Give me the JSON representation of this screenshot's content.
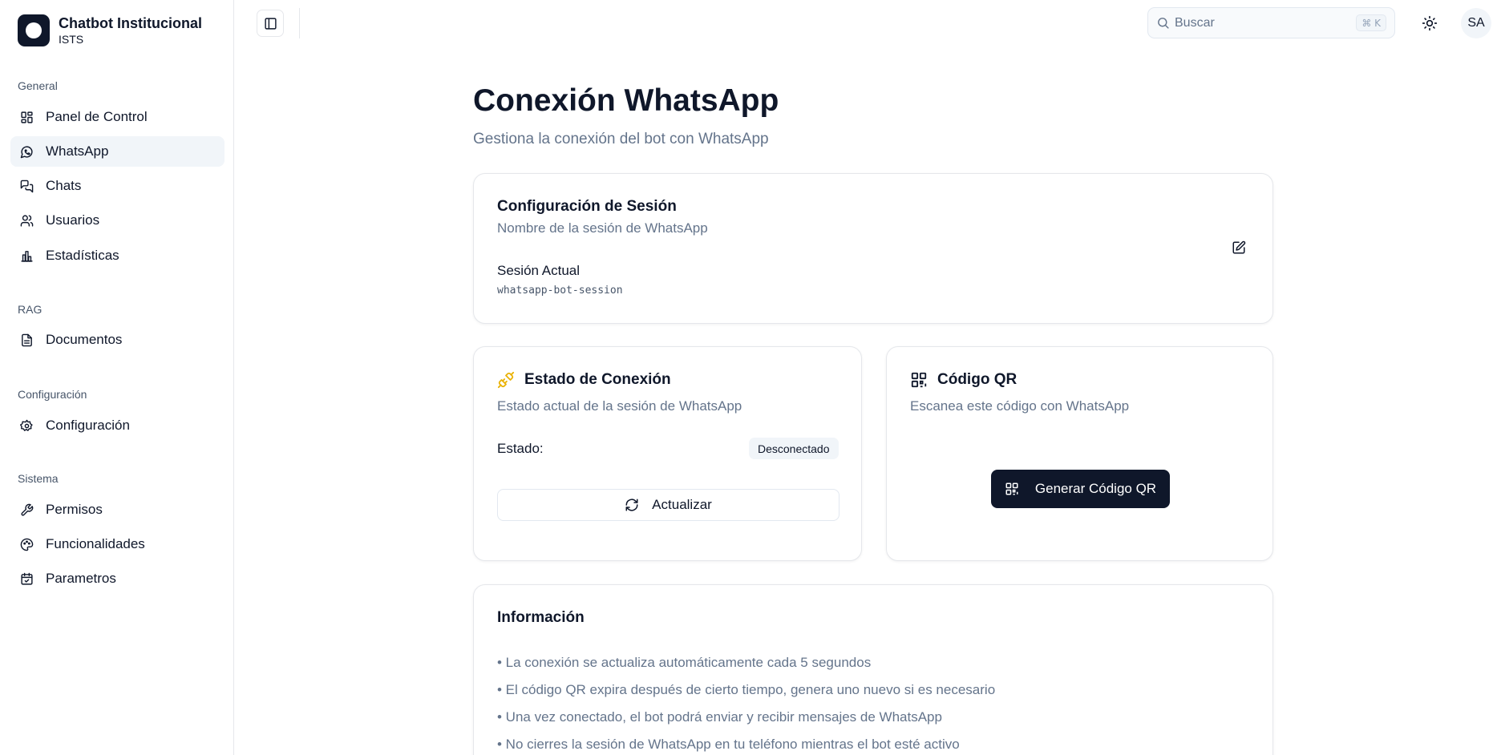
{
  "brand": {
    "title": "Chatbot Institucional",
    "subtitle": "ISTS"
  },
  "sidebar": {
    "groups": [
      {
        "label": "General",
        "items": [
          {
            "label": "Panel de Control",
            "icon": "layout-grid-icon"
          },
          {
            "label": "WhatsApp",
            "icon": "message-circle-icon",
            "active": true
          },
          {
            "label": "Chats",
            "icon": "messages-square-icon"
          },
          {
            "label": "Usuarios",
            "icon": "users-icon"
          },
          {
            "label": "Estadísticas",
            "icon": "bar-chart-icon"
          }
        ]
      },
      {
        "label": "RAG",
        "items": [
          {
            "label": "Documentos",
            "icon": "file-text-icon"
          }
        ]
      },
      {
        "label": "Configuración",
        "items": [
          {
            "label": "Configuración",
            "icon": "settings-icon"
          }
        ]
      },
      {
        "label": "Sistema",
        "items": [
          {
            "label": "Permisos",
            "icon": "wrench-icon"
          },
          {
            "label": "Funcionalidades",
            "icon": "palette-icon"
          },
          {
            "label": "Parametros",
            "icon": "calendar-check-icon"
          }
        ]
      }
    ]
  },
  "header": {
    "search_placeholder": "Buscar",
    "search_shortcut": "⌘ K",
    "avatar_initials": "SA"
  },
  "page": {
    "title": "Conexión WhatsApp",
    "subtitle": "Gestiona la conexión del bot con WhatsApp"
  },
  "session_card": {
    "title": "Configuración de Sesión",
    "description": "Nombre de la sesión de WhatsApp",
    "label": "Sesión Actual",
    "value": "whatsapp-bot-session"
  },
  "status_card": {
    "title": "Estado de Conexión",
    "description": "Estado actual de la sesión de WhatsApp",
    "status_label": "Estado:",
    "status_value": "Desconectado",
    "refresh_label": "Actualizar",
    "status_color": "#eab308"
  },
  "qr_card": {
    "title": "Código QR",
    "description": "Escanea este código con WhatsApp",
    "button_label": "Generar Código QR"
  },
  "info_card": {
    "title": "Información",
    "lines": [
      "• La conexión se actualiza automáticamente cada 5 segundos",
      "• El código QR expira después de cierto tiempo, genera uno nuevo si es necesario",
      "• Una vez conectado, el bot podrá enviar y recibir mensajes de WhatsApp",
      "• No cierres la sesión de WhatsApp en tu teléfono mientras el bot esté activo"
    ]
  },
  "colors": {
    "primary": "#0f172a",
    "muted": "#64748b",
    "border": "#e5e7eb"
  }
}
